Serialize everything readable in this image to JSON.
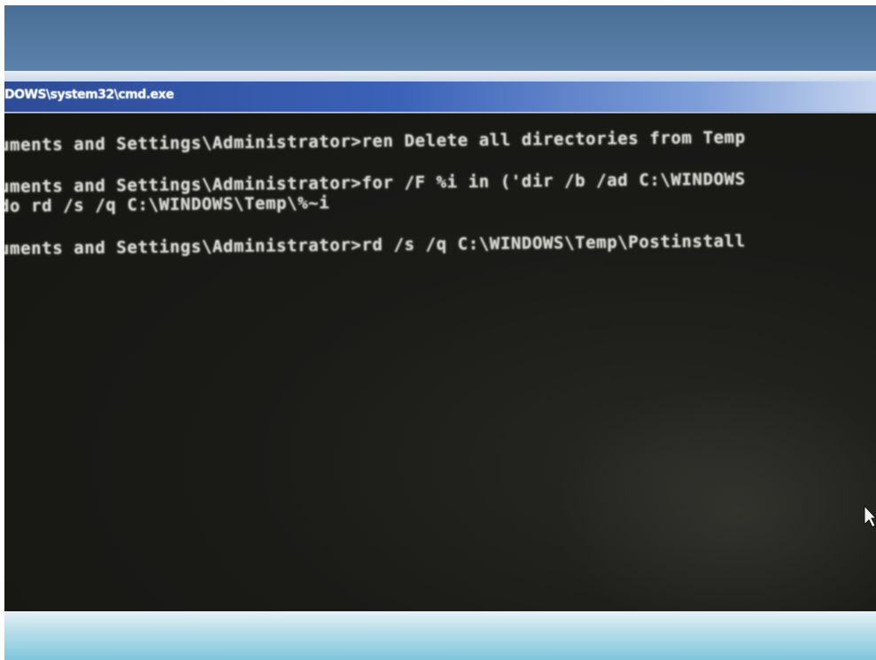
{
  "window": {
    "title": "DOWS\\system32\\cmd.exe"
  },
  "console": {
    "lines": [
      "uments and Settings\\Administrator>ren Delete all directories from Temp",
      "uments and Settings\\Administrator>for /F %i in ('dir /b /ad C:\\WINDOWS",
      "do rd /s /q C:\\WINDOWS\\Temp\\%~i",
      "uments and Settings\\Administrator>rd /s /q C:\\WINDOWS\\Temp\\Postinstall"
    ]
  },
  "colors": {
    "console_background": "#1a1a17",
    "console_text": "#d6d6d0",
    "titlebar": "#2d4b96"
  },
  "icons": {
    "pointer": "mouse-pointer-icon"
  }
}
